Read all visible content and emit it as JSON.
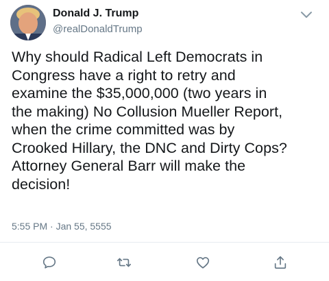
{
  "tweet": {
    "author_name": "Donald J. Trump",
    "author_handle": "@realDonaldTrump",
    "text": "Why should Radical Left Democrats in\nCongress have a right to retry and\nexamine the $35,000,000 (two years in\nthe making) No Collusion Mueller Report,\nwhen the crime committed was by\nCrooked Hillary, the DNC and Dirty Cops?\nAttorney General Barr will make the\ndecision!",
    "timestamp": "5:55 PM · Jan 55, 5555"
  },
  "icons": {
    "more": "chevron-down-icon",
    "reply": "reply-icon",
    "retweet": "retweet-icon",
    "like": "heart-icon",
    "share": "share-icon"
  },
  "colors": {
    "text": "#14171a",
    "secondary": "#657786",
    "icon": "#657786",
    "divider": "#e6ecf0"
  }
}
